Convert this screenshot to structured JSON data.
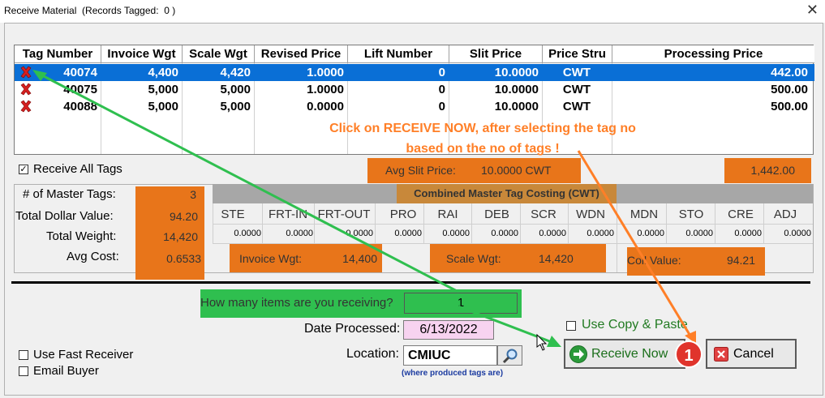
{
  "window": {
    "title": "Receive Material  (Records Tagged:  0 )"
  },
  "grid": {
    "headers": [
      "Tag Number",
      "Invoice Wgt",
      "Scale Wgt",
      "Revised Price",
      "Lift Number",
      "Slit Price",
      "Price Stru",
      "Processing Price"
    ],
    "rows": [
      {
        "tag": "40074",
        "invoice": "4,400",
        "scale": "4,420",
        "revised": "1.0000",
        "lift": "0",
        "slit": "10.0000",
        "stru": "CWT",
        "proc": "442.00"
      },
      {
        "tag": "40075",
        "invoice": "5,000",
        "scale": "5,000",
        "revised": "1.0000",
        "lift": "0",
        "slit": "10.0000",
        "stru": "CWT",
        "proc": "500.00"
      },
      {
        "tag": "40088",
        "invoice": "5,000",
        "scale": "5,000",
        "revised": "0.0000",
        "lift": "0",
        "slit": "10.0000",
        "stru": "CWT",
        "proc": "500.00"
      }
    ]
  },
  "annotation": {
    "line1": "Click on RECEIVE NOW, after selecting the tag no",
    "line2": "based on the no of tags !",
    "badge": "1"
  },
  "receive_all": {
    "label": "Receive All Tags",
    "checked": "✓"
  },
  "avg_slit": {
    "label": "Avg Slit Price:",
    "value": "10.0000 CWT"
  },
  "total_proc": "1,442.00",
  "summary": {
    "master_tags_label": "# of Master Tags:",
    "master_tags": "3",
    "dollar_label": "Total Dollar Value:",
    "dollar": "94.20",
    "weight_label": "Total Weight:",
    "weight": "14,420",
    "avg_label": "Avg Cost:",
    "avg": "0.6533"
  },
  "costing": {
    "title": "Combined Master Tag Costing (CWT)",
    "columns": [
      "STE",
      "FRT-IN",
      "FRT-OUT",
      "PRO",
      "RAI",
      "DEB",
      "SCR",
      "WDN",
      "MDN",
      "STO",
      "CRE",
      "ADJ"
    ],
    "values": [
      "0.0000",
      "0.0000",
      "0.0000",
      "0.0000",
      "0.0000",
      "0.0000",
      "0.0000",
      "0.0000",
      "0.0000",
      "0.0000",
      "0.0000",
      "0.0000"
    ]
  },
  "invoice_wgt": {
    "label": "Invoice Wgt:",
    "value": "14,400"
  },
  "scale_wgt": {
    "label": "Scale Wgt:",
    "value": "14,420"
  },
  "coil_value": {
    "label": "Coil Value:",
    "value": "94.21"
  },
  "form": {
    "how_many_label": "How many items are you receiving?",
    "how_many": "1",
    "date_label": "Date Processed:",
    "date": "6/13/2022",
    "location_label": "Location:",
    "location": "CMIUC",
    "location_note": "(where produced tags are)",
    "copy_paste": "Use Copy & Paste",
    "fast_receiver": "Use Fast Receiver",
    "email_buyer": "Email Buyer"
  },
  "buttons": {
    "receive": "Receive Now",
    "cancel": "Cancel"
  },
  "colors": {
    "orange": "#e8751a",
    "green": "#2fbf4f",
    "selection": "#0a6fd6",
    "annotation": "#ff7f27",
    "badge": "#e0342c"
  }
}
